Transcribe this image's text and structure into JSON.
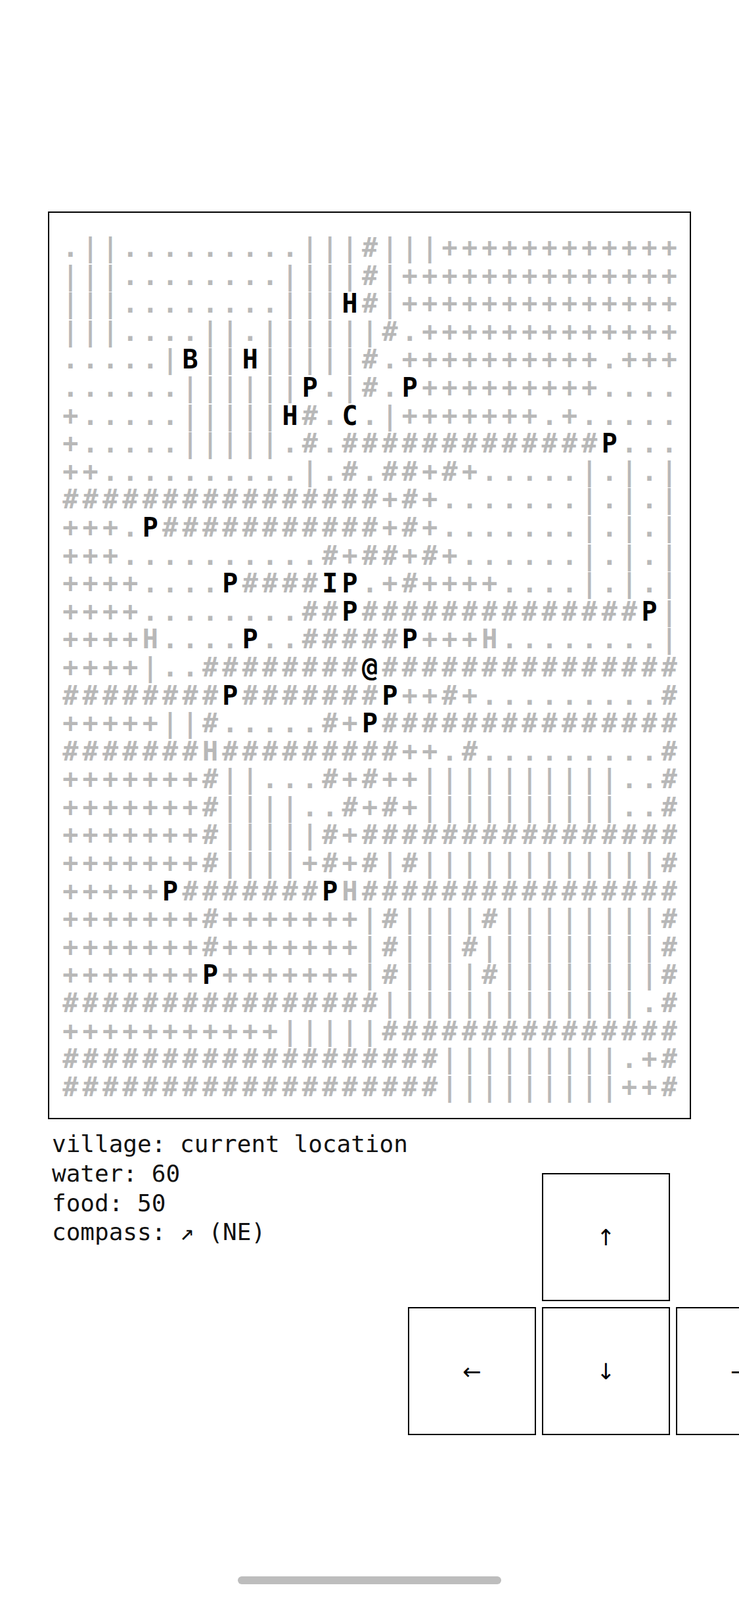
{
  "map": {
    "rows": [
      [
        {
          "text": ".||.........|||#|||++++++++++++",
          "highlight": false
        }
      ],
      [
        {
          "text": "|||........||||#|++++++++++++++",
          "highlight": false
        }
      ],
      [
        {
          "text": "|||........|||",
          "highlight": false
        },
        {
          "text": "H",
          "highlight": true
        },
        {
          "text": "#|++++++++++++++",
          "highlight": false
        }
      ],
      [
        {
          "text": "|||....||.||||||#.+++++++++++++",
          "highlight": false
        }
      ],
      [
        {
          "text": ".....|",
          "highlight": false
        },
        {
          "text": "B",
          "highlight": true
        },
        {
          "text": "||",
          "highlight": false
        },
        {
          "text": "H",
          "highlight": true
        },
        {
          "text": "|||||#.++++++++++.+++",
          "highlight": false
        }
      ],
      [
        {
          "text": "......||||||",
          "highlight": false
        },
        {
          "text": "P",
          "highlight": true
        },
        {
          "text": ".|#.",
          "highlight": false
        },
        {
          "text": "P",
          "highlight": true
        },
        {
          "text": "+++++++++....",
          "highlight": false
        }
      ],
      [
        {
          "text": "+.....|||||",
          "highlight": false
        },
        {
          "text": "H",
          "highlight": true
        },
        {
          "text": "#.",
          "highlight": false
        },
        {
          "text": "C",
          "highlight": true
        },
        {
          "text": ".|+++++++.+.....",
          "highlight": false
        }
      ],
      [
        {
          "text": "+.....|||||.#.#############",
          "highlight": false
        },
        {
          "text": "P",
          "highlight": true
        },
        {
          "text": "...",
          "highlight": false
        }
      ],
      [
        {
          "text": "++..........|.#.##+#+.....|.|.|",
          "highlight": false
        }
      ],
      [
        {
          "text": "################+#+.......|.|.|",
          "highlight": false
        }
      ],
      [
        {
          "text": "+++.",
          "highlight": false
        },
        {
          "text": "P",
          "highlight": true
        },
        {
          "text": "###########+#+.......|.|.|",
          "highlight": false
        }
      ],
      [
        {
          "text": "+++..........#+##+#+......|.|.|",
          "highlight": false
        }
      ],
      [
        {
          "text": "++++....",
          "highlight": false
        },
        {
          "text": "P",
          "highlight": true
        },
        {
          "text": "####",
          "highlight": false
        },
        {
          "text": "IP",
          "highlight": true
        },
        {
          "text": ".+#++++....|.|.|",
          "highlight": false
        }
      ],
      [
        {
          "text": "++++........##",
          "highlight": false
        },
        {
          "text": "P",
          "highlight": true
        },
        {
          "text": "##############",
          "highlight": false
        },
        {
          "text": "P",
          "highlight": true
        },
        {
          "text": "|",
          "highlight": false
        }
      ],
      [
        {
          "text": "++++H....",
          "highlight": false
        },
        {
          "text": "P",
          "highlight": true
        },
        {
          "text": "..#####",
          "highlight": false
        },
        {
          "text": "P",
          "highlight": true
        },
        {
          "text": "+++H........|",
          "highlight": false
        }
      ],
      [
        {
          "text": "++++|..########",
          "highlight": false
        },
        {
          "text": "@",
          "highlight": true
        },
        {
          "text": "###############",
          "highlight": false
        }
      ],
      [
        {
          "text": "########",
          "highlight": false
        },
        {
          "text": "P",
          "highlight": true
        },
        {
          "text": "#######",
          "highlight": false
        },
        {
          "text": "P",
          "highlight": true
        },
        {
          "text": "++#+.........#",
          "highlight": false
        }
      ],
      [
        {
          "text": "+++++||#.....#+",
          "highlight": false
        },
        {
          "text": "P",
          "highlight": true
        },
        {
          "text": "###############",
          "highlight": false
        }
      ],
      [
        {
          "text": "#######H#########++.#.........#",
          "highlight": false
        }
      ],
      [
        {
          "text": "+++++++#||...#+#++||||||||||..#",
          "highlight": false
        }
      ],
      [
        {
          "text": "+++++++#||||..#+#+||||||||||..#",
          "highlight": false
        }
      ],
      [
        {
          "text": "+++++++#|||||#+################",
          "highlight": false
        }
      ],
      [
        {
          "text": "+++++++#||||+#+#|#||||||||||||#",
          "highlight": false
        }
      ],
      [
        {
          "text": "+++++",
          "highlight": false
        },
        {
          "text": "P",
          "highlight": true
        },
        {
          "text": "#######",
          "highlight": false
        },
        {
          "text": "P",
          "highlight": true
        },
        {
          "text": "H################",
          "highlight": false
        }
      ],
      [
        {
          "text": "+++++++#+++++++|#||||#||||||||#",
          "highlight": false
        }
      ],
      [
        {
          "text": "+++++++#+++++++|#|||#|||||||||#",
          "highlight": false
        }
      ],
      [
        {
          "text": "+++++++",
          "highlight": false
        },
        {
          "text": "P",
          "highlight": true
        },
        {
          "text": "+++++++|#||||#||||||||#",
          "highlight": false
        }
      ],
      [
        {
          "text": "################|||||||||||||.#",
          "highlight": false
        }
      ],
      [
        {
          "text": "+++++++++++|||||###############",
          "highlight": false
        }
      ],
      [
        {
          "text": "###################|||||||||.+#",
          "highlight": false
        }
      ],
      [
        {
          "text": "###################|||||||||++#",
          "highlight": false
        }
      ]
    ]
  },
  "status": [
    "village: current location",
    "water: 60",
    "food: 50",
    "compass: ↗ (NE)"
  ],
  "controls": [
    {
      "label": "↑"
    },
    {
      "label": "←"
    },
    {
      "label": "↓"
    },
    {
      "label": "→"
    }
  ]
}
